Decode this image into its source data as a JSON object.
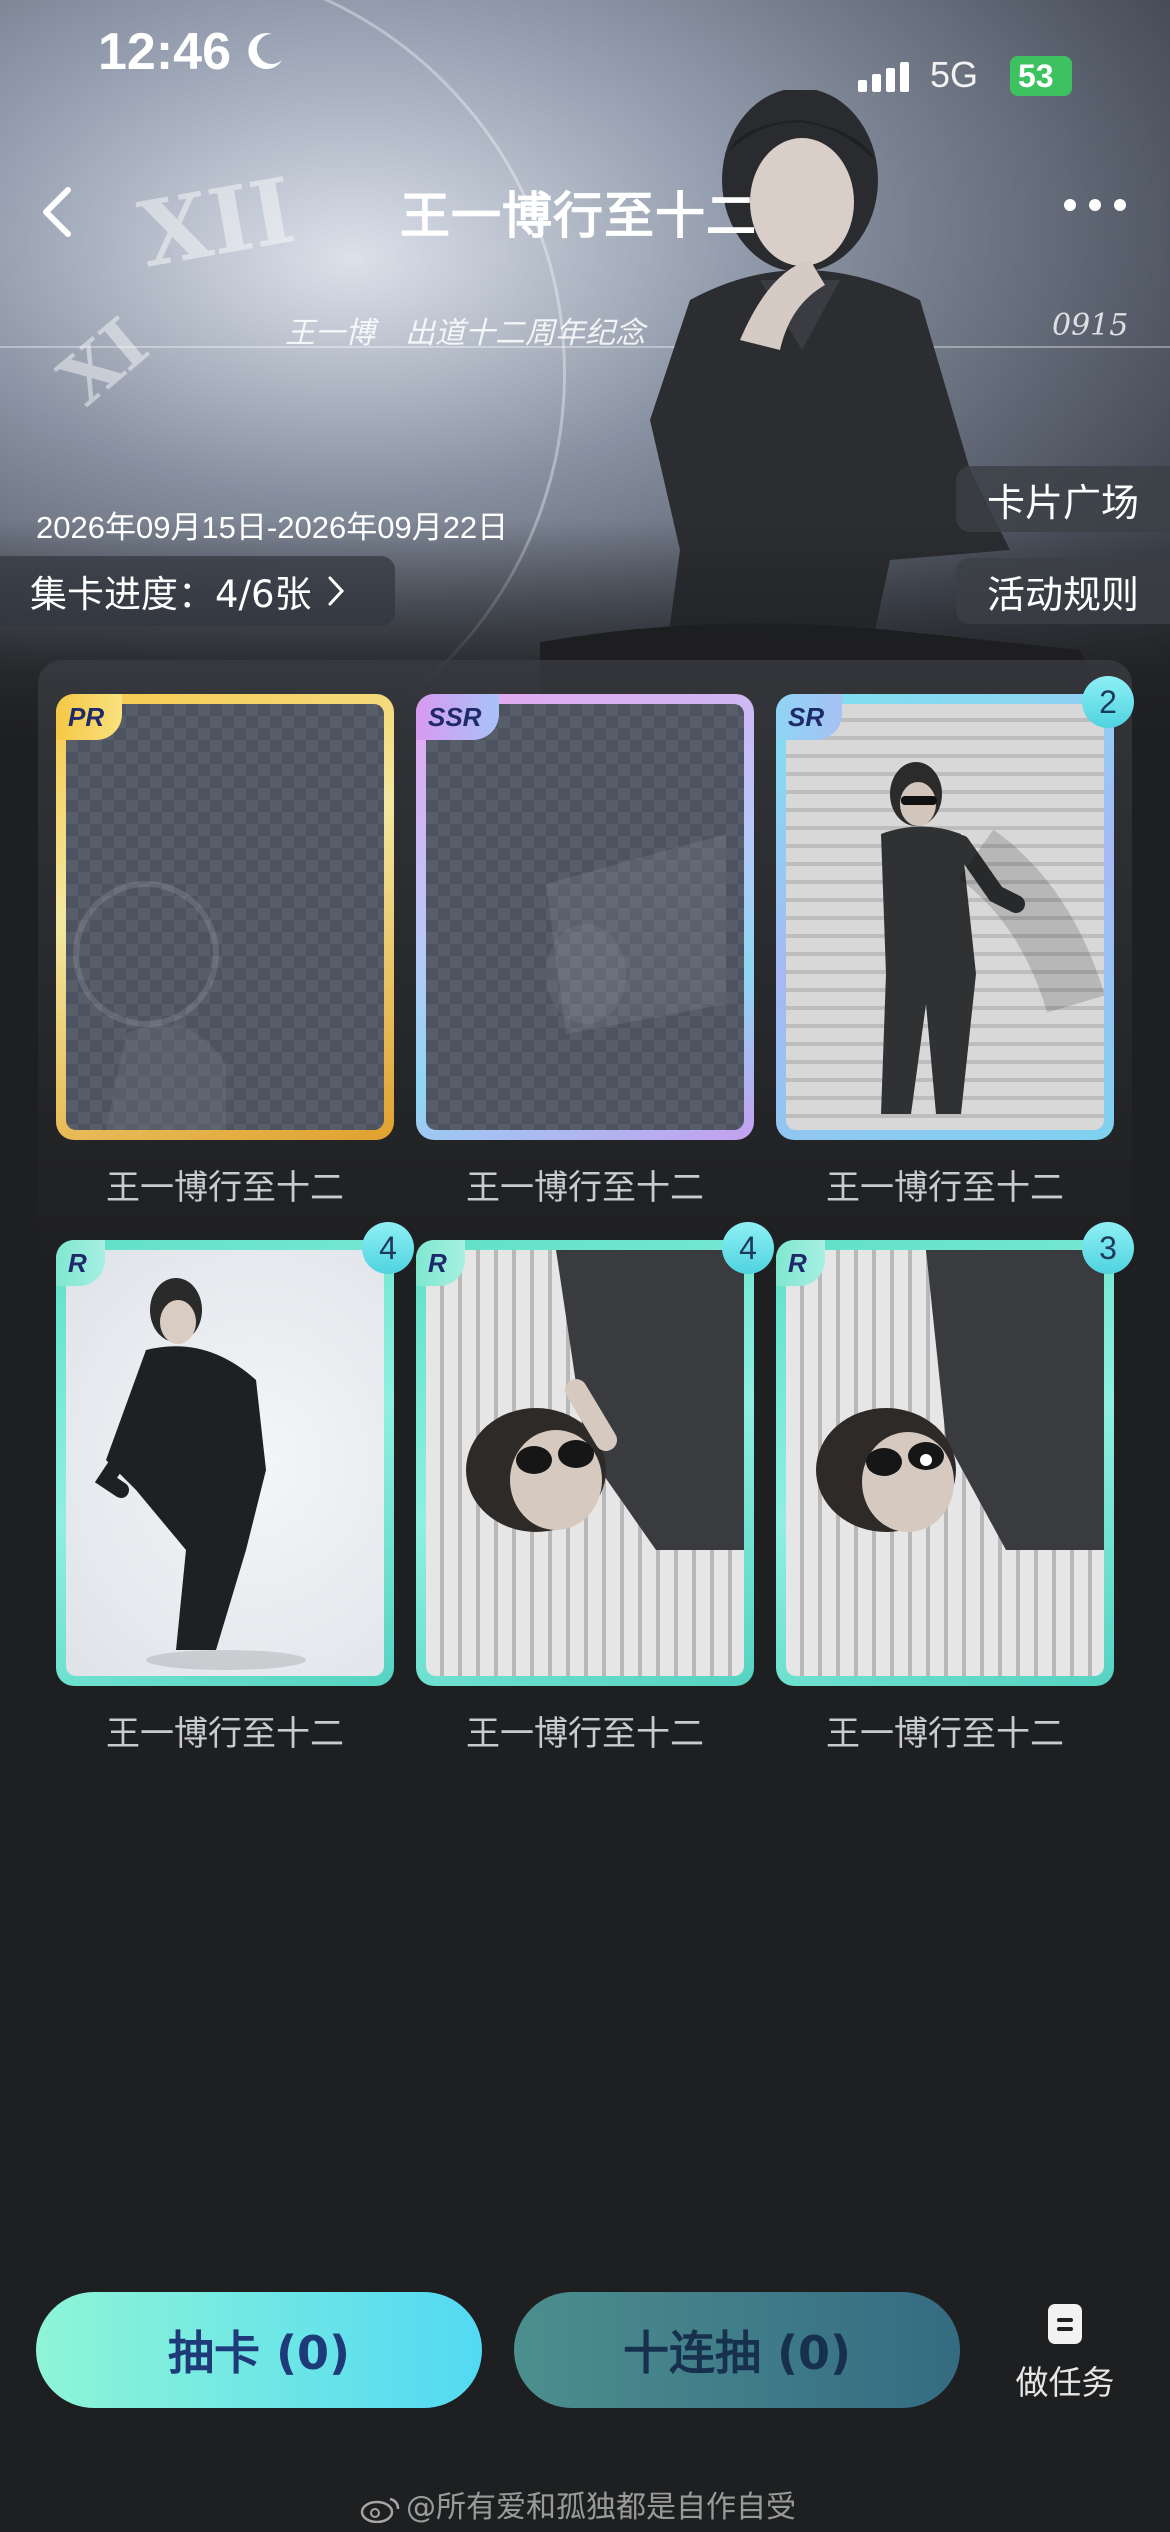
{
  "status_bar": {
    "time": "12:46",
    "network": "5G",
    "battery": "53"
  },
  "header": {
    "title": "王一博行至十二",
    "back_icon": "chevron-left-icon",
    "more_icon": "more-dots-icon"
  },
  "banner": {
    "subtitle": "王一博　出道十二周年纪念",
    "date_mark": "0915",
    "date_range": "2026年09月15日-2026年09月22日",
    "progress_label": "集卡进度：4/6张",
    "card_square_label": "卡片广场",
    "rules_label": "活动规则"
  },
  "cards": [
    {
      "rarity": "PR",
      "name": "王一博行至十二",
      "count": "",
      "owned": false
    },
    {
      "rarity": "SSR",
      "name": "王一博行至十二",
      "count": "",
      "owned": false
    },
    {
      "rarity": "SR",
      "name": "王一博行至十二",
      "count": "2",
      "owned": true
    },
    {
      "rarity": "R",
      "name": "王一博行至十二",
      "count": "4",
      "owned": true
    },
    {
      "rarity": "R",
      "name": "王一博行至十二",
      "count": "4",
      "owned": true
    },
    {
      "rarity": "R",
      "name": "王一博行至十二",
      "count": "3",
      "owned": true
    }
  ],
  "actions": {
    "draw_label": "抽卡 (0)",
    "ten_draw_label": "十连抽 (0)",
    "task_label": "做任务"
  },
  "watermark": "@所有爱和孤独都是自作自受",
  "colors": {
    "background": "#1e1f21",
    "draw_button": "#52d9f3",
    "ten_draw_button": "#346b82",
    "badge": "#4fd3e0"
  }
}
